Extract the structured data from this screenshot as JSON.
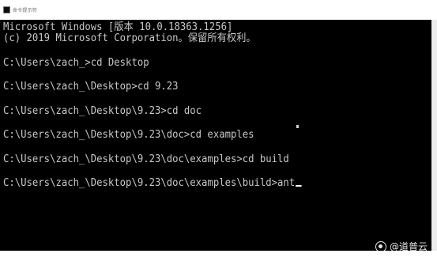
{
  "window": {
    "title": "命令提示符",
    "icon": "console-icon"
  },
  "console": {
    "header": [
      "Microsoft Windows [版本 10.0.18363.1256]",
      "(c) 2019 Microsoft Corporation。保留所有权利。"
    ],
    "commands": [
      "C:\\Users\\zach_>cd Desktop",
      "C:\\Users\\zach_\\Desktop>cd 9.23",
      "C:\\Users\\zach_\\Desktop\\9.23>cd doc",
      "C:\\Users\\zach_\\Desktop\\9.23\\doc>cd examples",
      "C:\\Users\\zach_\\Desktop\\9.23\\doc\\examples>cd build",
      "C:\\Users\\zach_\\Desktop\\9.23\\doc\\examples\\build>ant"
    ],
    "text_color": "#c8c8c8",
    "background": "#000000"
  },
  "watermark": {
    "text": "@道普云",
    "icon": "brand-logo-icon"
  }
}
